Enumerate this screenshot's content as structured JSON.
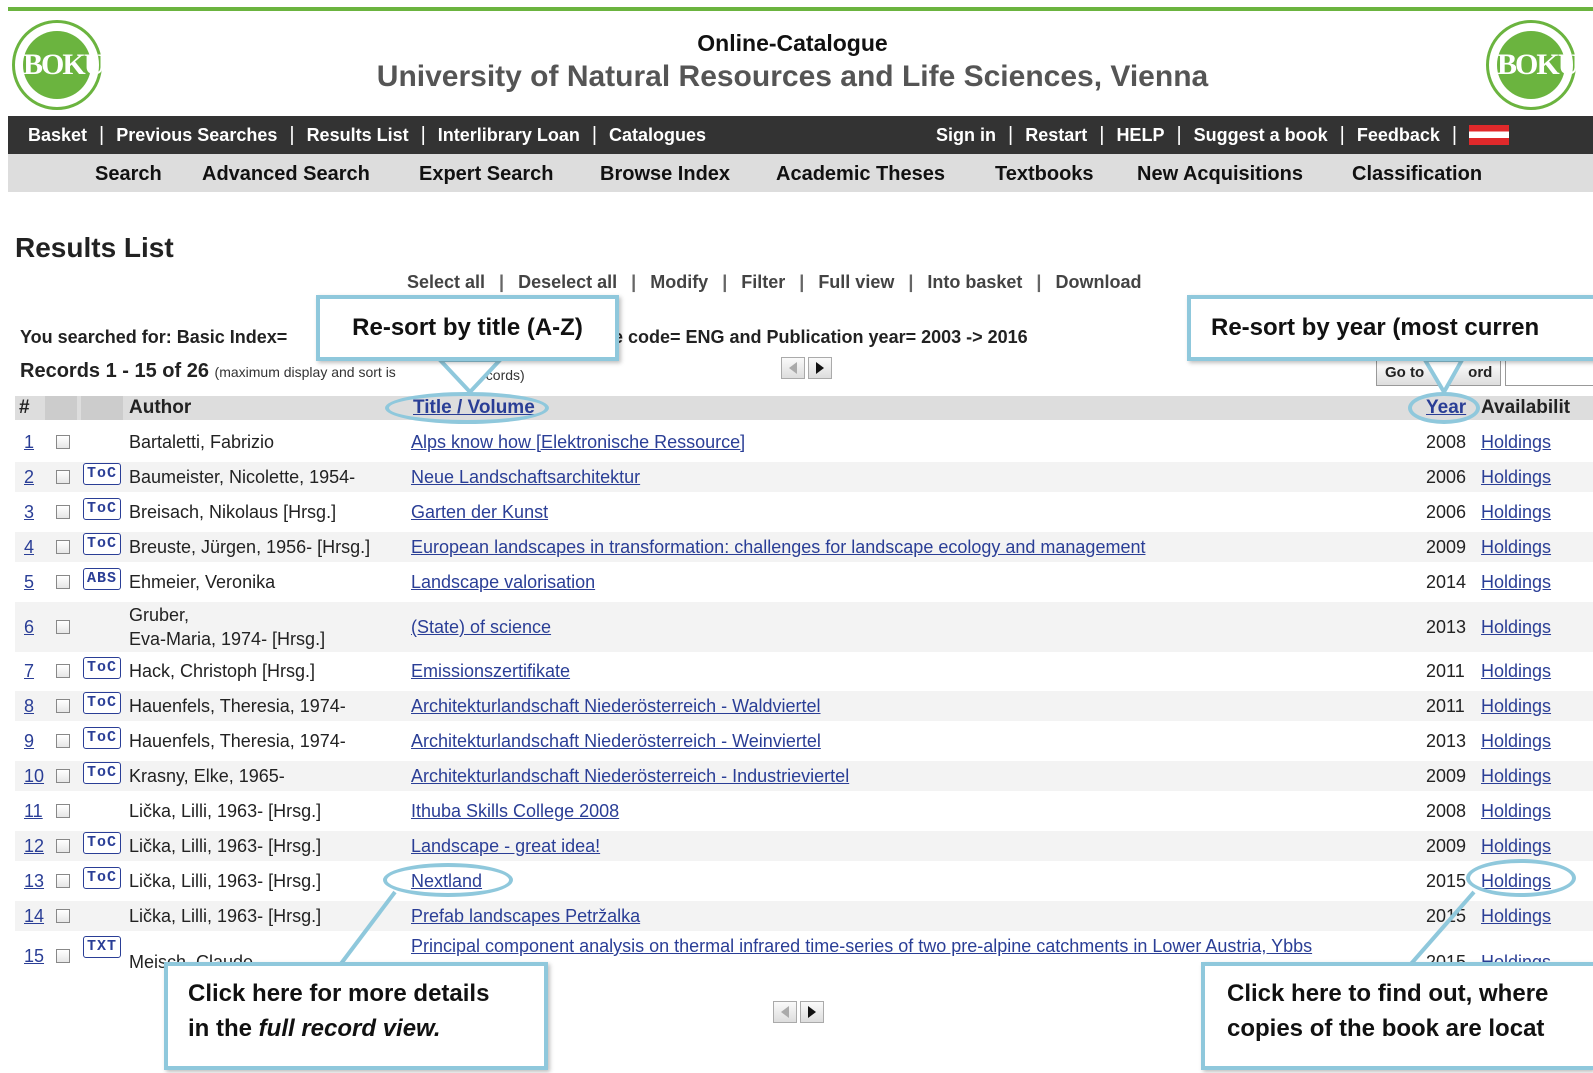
{
  "header": {
    "logo_left_text": "BOKU",
    "logo_right_text": "BOKU",
    "title": "Online-Catalogue",
    "subtitle": "University of Natural Resources and Life Sciences, Vienna"
  },
  "nav_left": [
    "Basket",
    "Previous Searches",
    "Results List",
    "Interlibrary Loan",
    "Catalogues"
  ],
  "nav_right": [
    "Sign in",
    "Restart",
    "HELP",
    "Suggest a book",
    "Feedback"
  ],
  "subnav": [
    "Search",
    "Advanced Search",
    "Expert Search",
    "Browse Index",
    "Academic Theses",
    "Textbooks",
    "New Acquisitions",
    "Classification"
  ],
  "results": {
    "heading": "Results List",
    "actions": [
      "Select all",
      "Deselect all",
      "Modify",
      "Filter",
      "Full view",
      "Into basket",
      "Download"
    ],
    "searched_left": "You searched for: Basic Index=",
    "searched_right": "e code= ENG and Publication year= 2003 -> 2016",
    "records_main": "Records 1 - 15 of 26",
    "records_note_left": "(maximum display and sort is",
    "records_note_right": "ecords)",
    "goto_label": "Go to",
    "goto_label2": "ord"
  },
  "table": {
    "headers": {
      "num": "#",
      "author": "Author",
      "title": "Title / Volume",
      "year": "Year",
      "availability": "Availabilit"
    },
    "rows": [
      {
        "num": "1",
        "badge": "",
        "author": [
          "Bartaletti, Fabrizio"
        ],
        "title": "Alps know how  [Elektronische Ressource]",
        "year": "2008",
        "holdings": "Holdings"
      },
      {
        "num": "2",
        "badge": "ToC",
        "author": [
          "Baumeister, Nicolette, 1954-"
        ],
        "title": "Neue Landschaftsarchitektur",
        "year": "2006",
        "holdings": "Holdings"
      },
      {
        "num": "3",
        "badge": "ToC",
        "author": [
          "Breisach, Nikolaus [Hrsg.]"
        ],
        "title": "Garten der Kunst",
        "year": "2006",
        "holdings": "Holdings"
      },
      {
        "num": "4",
        "badge": "ToC",
        "author": [
          "Breuste, Jürgen, 1956- [Hrsg.]"
        ],
        "title": "European landscapes in transformation: challenges for landscape ecology and management",
        "year": "2009",
        "holdings": "Holdings"
      },
      {
        "num": "5",
        "badge": "ABS",
        "author": [
          "Ehmeier, Veronika"
        ],
        "title": "Landscape valorisation",
        "year": "2014",
        "holdings": "Holdings"
      },
      {
        "num": "6",
        "badge": "",
        "author": [
          "Gruber,",
          "Eva-Maria, 1974- [Hrsg.]"
        ],
        "title": "(State) of science",
        "year": "2013",
        "holdings": "Holdings"
      },
      {
        "num": "7",
        "badge": "ToC",
        "author": [
          "Hack, Christoph [Hrsg.]"
        ],
        "title": "Emissionszertifikate",
        "year": "2011",
        "holdings": "Holdings"
      },
      {
        "num": "8",
        "badge": "ToC",
        "author": [
          "Hauenfels, Theresia, 1974-"
        ],
        "title": "Architekturlandschaft Niederösterreich - Waldviertel",
        "year": "2011",
        "holdings": "Holdings"
      },
      {
        "num": "9",
        "badge": "ToC",
        "author": [
          "Hauenfels, Theresia, 1974-"
        ],
        "title": "Architekturlandschaft Niederösterreich - Weinviertel",
        "year": "2013",
        "holdings": "Holdings"
      },
      {
        "num": "10",
        "badge": "ToC",
        "author": [
          "Krasny, Elke, 1965-"
        ],
        "title": "Architekturlandschaft Niederösterreich - Industrieviertel",
        "year": "2009",
        "holdings": "Holdings"
      },
      {
        "num": "11",
        "badge": "",
        "author": [
          "Lička, Lilli, 1963- [Hrsg.]"
        ],
        "title": "Ithuba Skills College 2008",
        "year": "2008",
        "holdings": "Holdings"
      },
      {
        "num": "12",
        "badge": "ToC",
        "author": [
          "Lička, Lilli, 1963- [Hrsg.]"
        ],
        "title": "Landscape - great idea!",
        "year": "2009",
        "holdings": "Holdings"
      },
      {
        "num": "13",
        "badge": "ToC",
        "author": [
          "Lička, Lilli, 1963- [Hrsg.]"
        ],
        "title": "Nextland",
        "year": "2015",
        "holdings": "Holdings"
      },
      {
        "num": "14",
        "badge": "",
        "author": [
          "Lička, Lilli, 1963- [Hrsg.]"
        ],
        "title": "Prefab landscapes Petržalka",
        "year": "2015",
        "holdings": "Holdings"
      },
      {
        "num": "15",
        "badge": "TXT",
        "author": [
          "Meisch, Claude"
        ],
        "title": "Principal component analysis on thermal infrared time-series of two pre-alpine catchments in Lower Austria, Ybbs",
        "year": "2015",
        "holdings": "Holdings"
      }
    ]
  },
  "callouts": {
    "sort_title": "Re-sort by title (A-Z)",
    "sort_year": "Re-sort by year (most curren",
    "details_line1": "Click here for more details",
    "details_line2_normal": "in the ",
    "details_line2_italic": "full record view.",
    "holdings_line1": "Click here to find out, where",
    "holdings_line2": "copies of the book are locat"
  },
  "colors": {
    "link": "#2a3e96",
    "brand_green": "#6bb43f",
    "callout_border": "#8fc8dc",
    "navbar": "#333333"
  }
}
